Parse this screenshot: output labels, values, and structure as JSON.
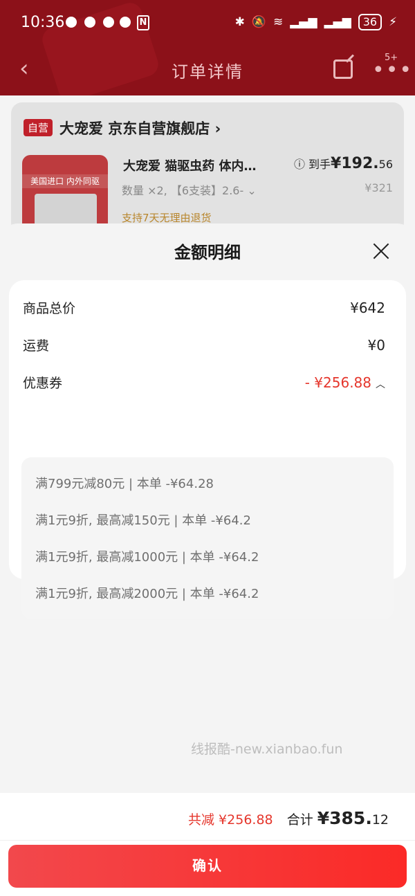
{
  "status_bar": {
    "time": "10:36",
    "battery": "36"
  },
  "header": {
    "title": "订单详情",
    "more_badge": "5+"
  },
  "order_card": {
    "self_operated_tag": "自营",
    "store_name": "大宠爱 京东自营旗舰店 ›",
    "product_name": "大宠爱 猫驱虫药 体内…",
    "net_price_label": "ⓘ 到手",
    "net_price": "¥192.",
    "net_price_cents": "56",
    "quantity_spec": "数量 ×2, 【6支装】2.6- ⌄",
    "original_price": "¥321",
    "refund_note": "支持7天无理由退货",
    "thumb_text": "美国进口 内外同驱"
  },
  "sheet": {
    "title": "金额明细",
    "rows": [
      {
        "label": "商品总价",
        "value": "¥642"
      },
      {
        "label": "运费",
        "value": "¥0"
      },
      {
        "label": "优惠券",
        "value": "- ¥256.88"
      }
    ],
    "coupons": [
      "满799元减80元 | 本单 -¥64.28",
      "满1元9折, 最高减150元 | 本单 -¥64.2",
      "满1元9折, 最高减1000元 | 本单 -¥64.2",
      "满1元9折, 最高减2000元 | 本单 -¥64.2"
    ]
  },
  "watermark": "线报酷-new.xianbao.fun",
  "footer": {
    "discount_total": "共减 ¥256.88",
    "total_label": "合计 ",
    "total_integer": "¥385.",
    "total_cents": "12",
    "confirm_label": "确认"
  },
  "colors": {
    "accent_red": "#e5362c",
    "header_bg": "#8c1119",
    "button_gradient_start": "#f2484c",
    "button_gradient_end": "#fb2a27"
  }
}
